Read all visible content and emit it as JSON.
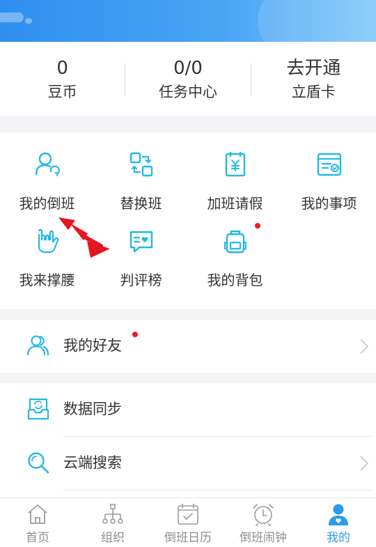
{
  "stats": [
    {
      "value": "0",
      "label": "豆币"
    },
    {
      "value": "0/0",
      "label": "任务中心"
    },
    {
      "value": "去开通",
      "label": "立盾卡"
    }
  ],
  "grid": [
    {
      "label": "我的倒班",
      "icon": "user-refresh-icon"
    },
    {
      "label": "替换班",
      "icon": "swap-icon"
    },
    {
      "label": "加班请假",
      "icon": "yen-document-icon"
    },
    {
      "label": "我的事项",
      "icon": "task-list-icon"
    },
    {
      "label": "我来撑腰",
      "icon": "rock-hand-icon"
    },
    {
      "label": "判评榜",
      "icon": "chat-heart-icon"
    },
    {
      "label": "我的背包",
      "icon": "backpack-icon"
    }
  ],
  "friends": {
    "label": "我的好友",
    "icon": "friends-icon"
  },
  "list": [
    {
      "label": "数据同步",
      "icon": "sync-inbox-icon"
    },
    {
      "label": "云端搜索",
      "icon": "search-icon"
    }
  ],
  "tabs": [
    {
      "label": "首页",
      "icon": "home-icon"
    },
    {
      "label": "组织",
      "icon": "org-chart-icon"
    },
    {
      "label": "倒班日历",
      "icon": "calendar-check-icon"
    },
    {
      "label": "倒班闹钟",
      "icon": "alarm-clock-icon"
    },
    {
      "label": "我的",
      "icon": "profile-icon"
    }
  ],
  "colors": {
    "accent": "#2a9be8",
    "icon_cyan": "#22b8e6",
    "badge_red": "#ee1c24",
    "annotation_red": "#e8141e"
  }
}
